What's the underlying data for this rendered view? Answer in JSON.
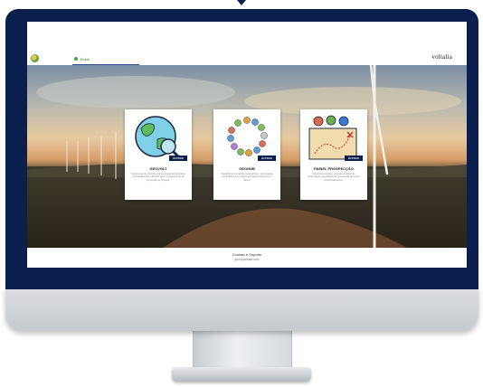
{
  "brand": "voltalia",
  "nav": {
    "tab_label": "Brasil"
  },
  "cards": [
    {
      "title": "GEOVOLT",
      "button": "Acessar",
      "description": "Ferramenta de consulta a áreas espaciais de dados socioambientais, eficiente para o mapeamento de propostas de projetos."
    },
    {
      "title": "GEOHUB",
      "button": "Acessar",
      "description": "Visualize as formações geográficas e informações geográficas dos projetos em desenvolvimento e ativos."
    },
    {
      "title": "PAINEL PROSPECÇÃO",
      "button": "Acessar",
      "description": "Painel para análise, consulta e edição de informações geográficas de prospecção de novos empreendimentos."
    }
  ],
  "footer": {
    "title": "Contato e Suporte",
    "subtitle": "geo@voltalia.com"
  },
  "colors": {
    "bezel": "#0b1f4e",
    "button": "#0b1f4e",
    "nav_underline": "#2d4b8f",
    "brand_green": "#3cab4a"
  },
  "icons": [
    "globe-magnifier-icon",
    "hub-circle-icon",
    "treasure-map-icon",
    "logo-icon"
  ]
}
